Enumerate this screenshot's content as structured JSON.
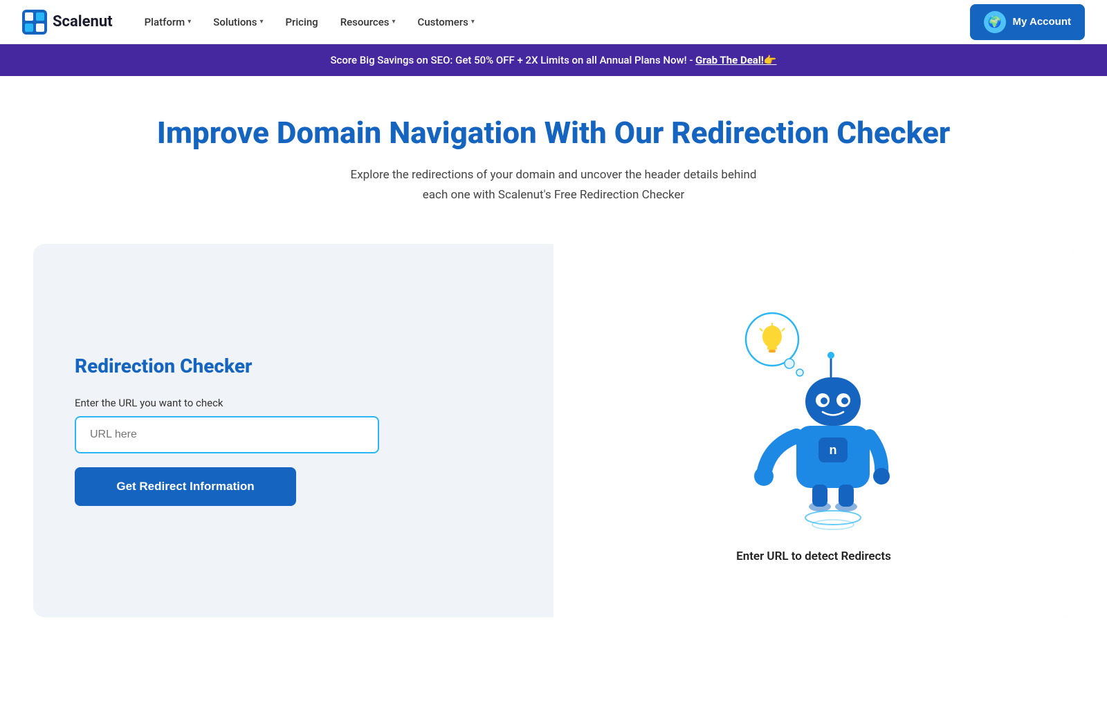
{
  "brand": {
    "name": "Scalenut",
    "logo_text": "Scalenut"
  },
  "navbar": {
    "links": [
      {
        "id": "platform",
        "label": "Platform",
        "has_dropdown": true
      },
      {
        "id": "solutions",
        "label": "Solutions",
        "has_dropdown": true
      },
      {
        "id": "pricing",
        "label": "Pricing",
        "has_dropdown": false
      },
      {
        "id": "resources",
        "label": "Resources",
        "has_dropdown": true
      },
      {
        "id": "customers",
        "label": "Customers",
        "has_dropdown": true
      }
    ],
    "cta_label": "My Account"
  },
  "promo": {
    "text": "Score Big Savings on SEO: Get 50% OFF + 2X Limits on all Annual Plans Now! - ",
    "link_text": "Grab The Deal!👉"
  },
  "hero": {
    "title": "Improve Domain Navigation With Our Redirection Checker",
    "subtitle_line1": "Explore the redirections of your domain and uncover the header details behind",
    "subtitle_line2": "each one with Scalenut's Free Redirection Checker"
  },
  "tool": {
    "title": "Redirection Checker",
    "input_label": "Enter the URL you want to check",
    "input_placeholder": "URL here",
    "button_label": "Get Redirect Information",
    "robot_caption": "Enter URL to detect Redirects"
  }
}
